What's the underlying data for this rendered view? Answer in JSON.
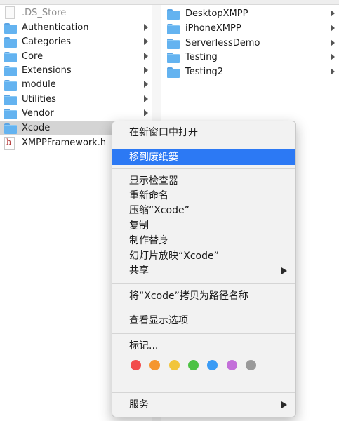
{
  "column1": {
    "items": [
      {
        "label": ".DS_Store",
        "icon": "document-icon",
        "dim": true,
        "arrow": false
      },
      {
        "label": "Authentication",
        "icon": "folder-icon",
        "arrow": true
      },
      {
        "label": "Categories",
        "icon": "folder-icon",
        "arrow": true
      },
      {
        "label": "Core",
        "icon": "folder-icon",
        "arrow": true
      },
      {
        "label": "Extensions",
        "icon": "folder-icon",
        "arrow": true
      },
      {
        "label": "module",
        "icon": "folder-icon",
        "arrow": true
      },
      {
        "label": "Utilities",
        "icon": "folder-icon",
        "arrow": true
      },
      {
        "label": "Vendor",
        "icon": "folder-icon",
        "arrow": true
      },
      {
        "label": "Xcode",
        "icon": "folder-icon",
        "arrow": false,
        "selected": true
      },
      {
        "label": "XMPPFramework.h",
        "icon": "header-file-icon",
        "icon_glyph": "h",
        "arrow": false
      }
    ]
  },
  "column2": {
    "items": [
      {
        "label": "DesktopXMPP",
        "icon": "folder-icon",
        "arrow": true
      },
      {
        "label": "iPhoneXMPP",
        "icon": "folder-icon",
        "arrow": true
      },
      {
        "label": "ServerlessDemo",
        "icon": "folder-icon",
        "arrow": true
      },
      {
        "label": "Testing",
        "icon": "folder-icon",
        "arrow": true
      },
      {
        "label": "Testing2",
        "icon": "folder-icon",
        "arrow": true
      }
    ]
  },
  "context_menu": {
    "open_new_window": "在新窗口中打开",
    "move_to_trash": "移到废纸篓",
    "get_info": "显示检查器",
    "rename": "重新命名",
    "compress": "压缩“Xcode”",
    "duplicate": "复制",
    "make_alias": "制作替身",
    "slideshow": "幻灯片放映“Xcode”",
    "share": "共享",
    "copy_path": "将“Xcode”拷贝为路径名称",
    "view_options": "查看显示选项",
    "tags": "标记...",
    "services": "服务",
    "highlighted": "move_to_trash"
  },
  "tag_colors": [
    {
      "name": "red",
      "hex": "#f24c4c"
    },
    {
      "name": "orange",
      "hex": "#f5962f"
    },
    {
      "name": "yellow",
      "hex": "#f2c53a"
    },
    {
      "name": "green",
      "hex": "#4cc243"
    },
    {
      "name": "blue",
      "hex": "#3a9bf5"
    },
    {
      "name": "purple",
      "hex": "#c36fd9"
    },
    {
      "name": "gray",
      "hex": "#9a9a9a"
    }
  ],
  "colors": {
    "highlight": "#2c79f4",
    "folder": "#64b3f0",
    "selection": "#d4d4d4"
  }
}
